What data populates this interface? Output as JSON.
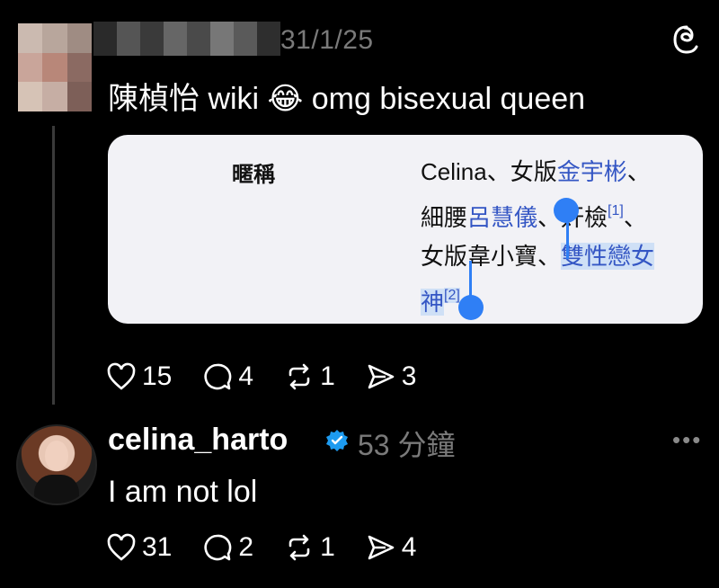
{
  "post": {
    "time": "31/1/25",
    "text": "陳楨怡 wiki 😂 omg bisexual queen",
    "card": {
      "key": "暱稱",
      "value_parts": {
        "p1": "Celina、女版",
        "l1": "金宇彬",
        "p2": "、",
        "p3": "細腰",
        "l2": "呂慧儀",
        "p4": "、奸檢",
        "s1": "[1]",
        "p5": "、",
        "p6": "女版韋小寶、",
        "l3": "雙性戀女",
        "l4": "神",
        "s2": "[2]"
      }
    },
    "stats": {
      "likes": "15",
      "comments": "4",
      "reposts": "1",
      "shares": "3"
    }
  },
  "reply": {
    "username": "celina_harto",
    "time": "53 分鐘",
    "more": "•••",
    "text": "I am not lol",
    "stats": {
      "likes": "31",
      "comments": "2",
      "reposts": "1",
      "shares": "4"
    }
  },
  "icons": [
    "threads-icon",
    "heart-icon",
    "comment-icon",
    "repost-icon",
    "share-icon",
    "verified-icon",
    "more-icon"
  ]
}
